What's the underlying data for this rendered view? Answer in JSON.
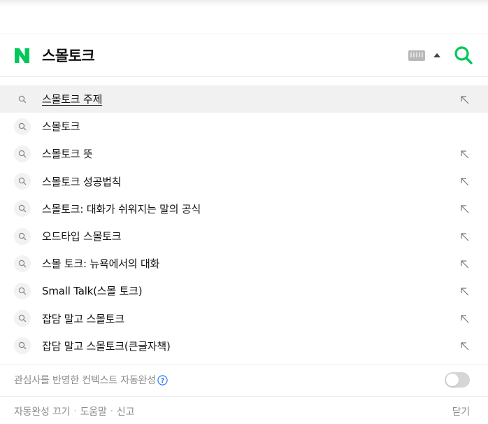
{
  "search": {
    "query": "스몰토크",
    "logo_color": "#03c75a"
  },
  "suggestions": [
    {
      "text": "스몰토크 주제",
      "active": true,
      "arrow": true
    },
    {
      "text": "스몰토크",
      "active": false,
      "arrow": false
    },
    {
      "text": "스몰토크 뜻",
      "active": false,
      "arrow": true
    },
    {
      "text": "스몰토크 성공법칙",
      "active": false,
      "arrow": true
    },
    {
      "text": "스몰토크: 대화가 쉬워지는 말의 공식",
      "active": false,
      "arrow": true
    },
    {
      "text": "오드타입 스몰토크",
      "active": false,
      "arrow": true
    },
    {
      "text": "스몰 토크: 뉴욕에서의 대화",
      "active": false,
      "arrow": true
    },
    {
      "text": "Small Talk(스몰 토크)",
      "active": false,
      "arrow": true
    },
    {
      "text": "잡담 말고 스몰토크",
      "active": false,
      "arrow": true
    },
    {
      "text": "잡담 말고 스몰토크(큰글자책)",
      "active": false,
      "arrow": true
    }
  ],
  "context": {
    "label": "관심사를 반영한 컨텍스트 자동완성",
    "toggle_on": false,
    "help_color": "#2f7df6"
  },
  "footer": {
    "autocomplete_off": "자동완성 끄기",
    "help": "도움말",
    "report": "신고",
    "close": "닫기"
  }
}
